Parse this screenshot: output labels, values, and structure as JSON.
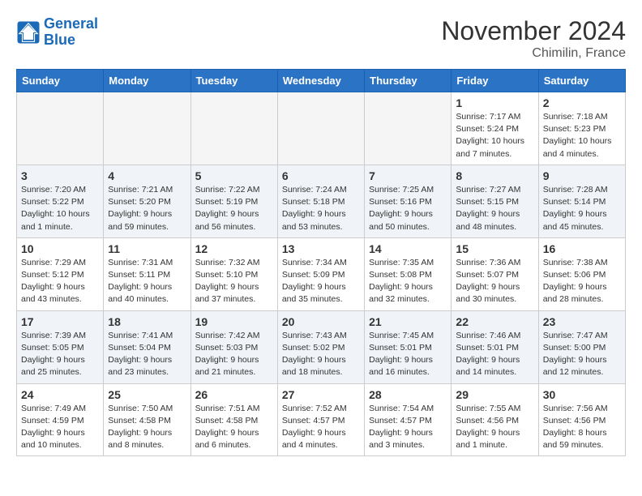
{
  "header": {
    "logo_line1": "General",
    "logo_line2": "Blue",
    "month": "November 2024",
    "location": "Chimilin, France"
  },
  "weekdays": [
    "Sunday",
    "Monday",
    "Tuesday",
    "Wednesday",
    "Thursday",
    "Friday",
    "Saturday"
  ],
  "weeks": [
    [
      {
        "day": "",
        "info": ""
      },
      {
        "day": "",
        "info": ""
      },
      {
        "day": "",
        "info": ""
      },
      {
        "day": "",
        "info": ""
      },
      {
        "day": "",
        "info": ""
      },
      {
        "day": "1",
        "info": "Sunrise: 7:17 AM\nSunset: 5:24 PM\nDaylight: 10 hours\nand 7 minutes."
      },
      {
        "day": "2",
        "info": "Sunrise: 7:18 AM\nSunset: 5:23 PM\nDaylight: 10 hours\nand 4 minutes."
      }
    ],
    [
      {
        "day": "3",
        "info": "Sunrise: 7:20 AM\nSunset: 5:22 PM\nDaylight: 10 hours\nand 1 minute."
      },
      {
        "day": "4",
        "info": "Sunrise: 7:21 AM\nSunset: 5:20 PM\nDaylight: 9 hours\nand 59 minutes."
      },
      {
        "day": "5",
        "info": "Sunrise: 7:22 AM\nSunset: 5:19 PM\nDaylight: 9 hours\nand 56 minutes."
      },
      {
        "day": "6",
        "info": "Sunrise: 7:24 AM\nSunset: 5:18 PM\nDaylight: 9 hours\nand 53 minutes."
      },
      {
        "day": "7",
        "info": "Sunrise: 7:25 AM\nSunset: 5:16 PM\nDaylight: 9 hours\nand 50 minutes."
      },
      {
        "day": "8",
        "info": "Sunrise: 7:27 AM\nSunset: 5:15 PM\nDaylight: 9 hours\nand 48 minutes."
      },
      {
        "day": "9",
        "info": "Sunrise: 7:28 AM\nSunset: 5:14 PM\nDaylight: 9 hours\nand 45 minutes."
      }
    ],
    [
      {
        "day": "10",
        "info": "Sunrise: 7:29 AM\nSunset: 5:12 PM\nDaylight: 9 hours\nand 43 minutes."
      },
      {
        "day": "11",
        "info": "Sunrise: 7:31 AM\nSunset: 5:11 PM\nDaylight: 9 hours\nand 40 minutes."
      },
      {
        "day": "12",
        "info": "Sunrise: 7:32 AM\nSunset: 5:10 PM\nDaylight: 9 hours\nand 37 minutes."
      },
      {
        "day": "13",
        "info": "Sunrise: 7:34 AM\nSunset: 5:09 PM\nDaylight: 9 hours\nand 35 minutes."
      },
      {
        "day": "14",
        "info": "Sunrise: 7:35 AM\nSunset: 5:08 PM\nDaylight: 9 hours\nand 32 minutes."
      },
      {
        "day": "15",
        "info": "Sunrise: 7:36 AM\nSunset: 5:07 PM\nDaylight: 9 hours\nand 30 minutes."
      },
      {
        "day": "16",
        "info": "Sunrise: 7:38 AM\nSunset: 5:06 PM\nDaylight: 9 hours\nand 28 minutes."
      }
    ],
    [
      {
        "day": "17",
        "info": "Sunrise: 7:39 AM\nSunset: 5:05 PM\nDaylight: 9 hours\nand 25 minutes."
      },
      {
        "day": "18",
        "info": "Sunrise: 7:41 AM\nSunset: 5:04 PM\nDaylight: 9 hours\nand 23 minutes."
      },
      {
        "day": "19",
        "info": "Sunrise: 7:42 AM\nSunset: 5:03 PM\nDaylight: 9 hours\nand 21 minutes."
      },
      {
        "day": "20",
        "info": "Sunrise: 7:43 AM\nSunset: 5:02 PM\nDaylight: 9 hours\nand 18 minutes."
      },
      {
        "day": "21",
        "info": "Sunrise: 7:45 AM\nSunset: 5:01 PM\nDaylight: 9 hours\nand 16 minutes."
      },
      {
        "day": "22",
        "info": "Sunrise: 7:46 AM\nSunset: 5:01 PM\nDaylight: 9 hours\nand 14 minutes."
      },
      {
        "day": "23",
        "info": "Sunrise: 7:47 AM\nSunset: 5:00 PM\nDaylight: 9 hours\nand 12 minutes."
      }
    ],
    [
      {
        "day": "24",
        "info": "Sunrise: 7:49 AM\nSunset: 4:59 PM\nDaylight: 9 hours\nand 10 minutes."
      },
      {
        "day": "25",
        "info": "Sunrise: 7:50 AM\nSunset: 4:58 PM\nDaylight: 9 hours\nand 8 minutes."
      },
      {
        "day": "26",
        "info": "Sunrise: 7:51 AM\nSunset: 4:58 PM\nDaylight: 9 hours\nand 6 minutes."
      },
      {
        "day": "27",
        "info": "Sunrise: 7:52 AM\nSunset: 4:57 PM\nDaylight: 9 hours\nand 4 minutes."
      },
      {
        "day": "28",
        "info": "Sunrise: 7:54 AM\nSunset: 4:57 PM\nDaylight: 9 hours\nand 3 minutes."
      },
      {
        "day": "29",
        "info": "Sunrise: 7:55 AM\nSunset: 4:56 PM\nDaylight: 9 hours\nand 1 minute."
      },
      {
        "day": "30",
        "info": "Sunrise: 7:56 AM\nSunset: 4:56 PM\nDaylight: 8 hours\nand 59 minutes."
      }
    ]
  ]
}
